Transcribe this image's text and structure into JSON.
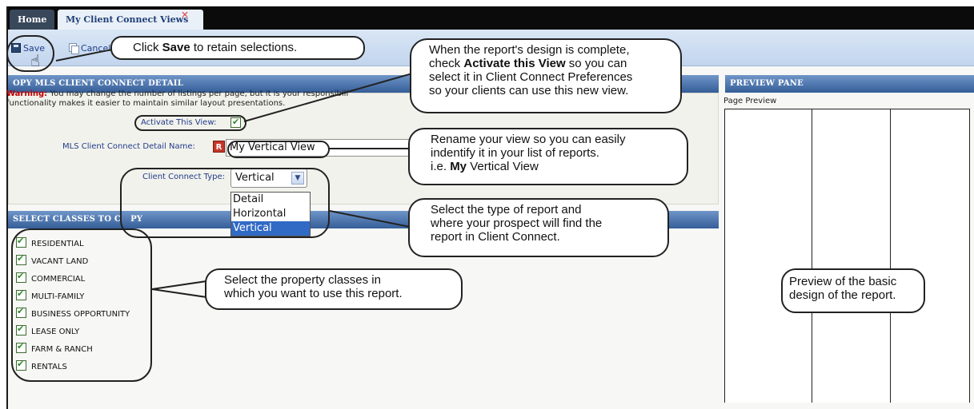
{
  "tabs": [
    {
      "label": "Home"
    },
    {
      "label": "My Client Connect Views",
      "close": "×"
    }
  ],
  "toolbar": {
    "save_label": "Save",
    "cancel_label": "Cancel"
  },
  "sections": {
    "copy_detail": "COPY MLS CLIENT CONNECT DETAIL",
    "copy_detail_visible": "OPY MLS CLIENT CONNECT DETAIL",
    "classes": "SELECT CLASSES TO COPY",
    "classes_visible": "SELECT CLASSES TO C",
    "classes_tail": "PY",
    "preview": "PREVIEW PANE"
  },
  "form": {
    "warning_label": "Warning:",
    "warning_text_line1": " You may change the number of listings per page, but it is your responsibili",
    "warning_text_line2": "functionality makes it easier to maintain similar layout presentations.",
    "activate_label": "Activate This View:",
    "activate_checked": true,
    "name_label": "MLS Client Connect Detail Name:",
    "required_badge": "R",
    "name_value": "My Vertical View",
    "type_label": "Client Connect Type:",
    "type_value": "Vertical",
    "type_options": [
      "Detail",
      "Horizontal",
      "Vertical"
    ]
  },
  "classes": [
    {
      "label": "RESIDENTIAL",
      "checked": true
    },
    {
      "label": "VACANT LAND",
      "checked": true
    },
    {
      "label": "COMMERCIAL",
      "checked": true
    },
    {
      "label": "MULTI-FAMILY",
      "checked": true
    },
    {
      "label": "BUSINESS OPPORTUNITY",
      "checked": true
    },
    {
      "label": "LEASE ONLY",
      "checked": true
    },
    {
      "label": "FARM & RANCH",
      "checked": true
    },
    {
      "label": "RENTALS",
      "checked": true
    }
  ],
  "preview": {
    "label": "Page Preview"
  },
  "callouts": {
    "save_pre": "Click ",
    "save_bold": "Save",
    "save_post": " to retain selections.",
    "activate_l1": "When the report's design is complete,",
    "activate_l2_pre": "check ",
    "activate_l2_bold": "Activate this View",
    "activate_l2_post": " so you can",
    "activate_l3": "select it in Client Connect Preferences",
    "activate_l4": "so your clients can use this new view.",
    "rename_l1": "Rename your view so you can easily",
    "rename_l2": "indentify it in your list of reports.",
    "rename_l3_pre": "i.e. ",
    "rename_l3_bold": "My",
    "rename_l3_post": " Vertical View",
    "type_l1": "Select the type of report and",
    "type_l2": "where your prospect will find the",
    "type_l3": "report in Client Connect.",
    "classes_l1": "Select the property classes in",
    "classes_l2": "which you want to use this report.",
    "preview_l1": "Preview of the basic",
    "preview_l2": "design of the report."
  }
}
